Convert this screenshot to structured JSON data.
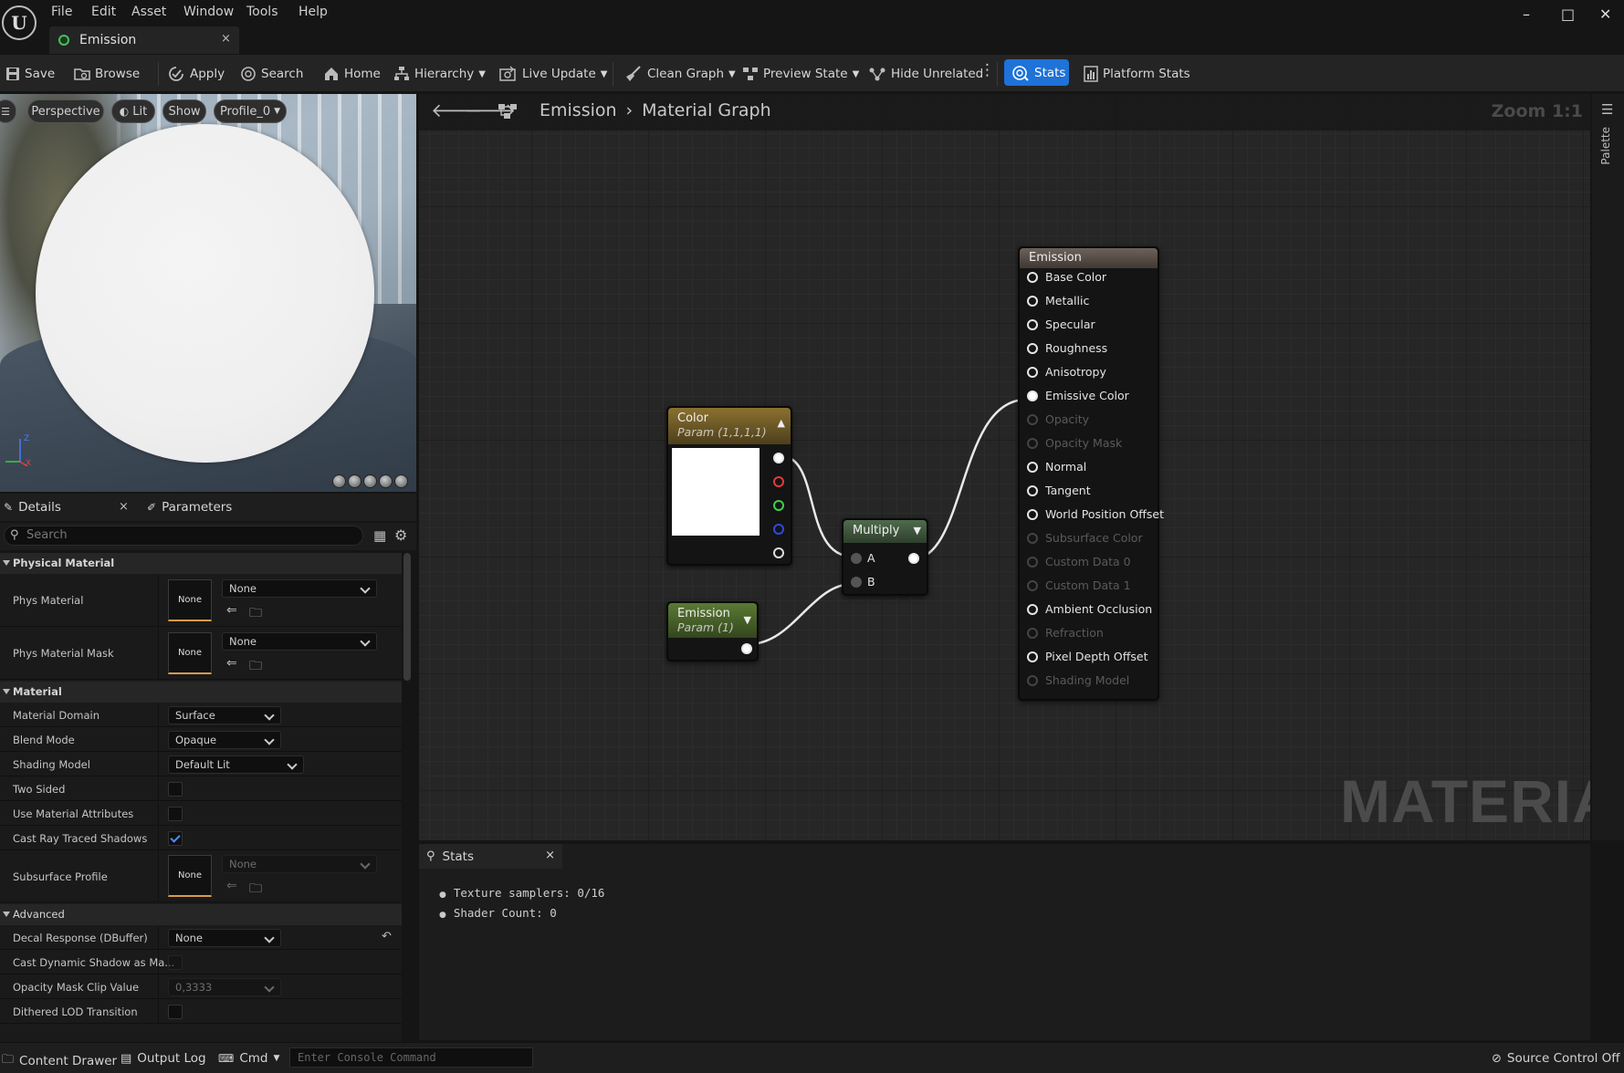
{
  "menu": [
    "File",
    "Edit",
    "Asset",
    "Window",
    "Tools",
    "Help"
  ],
  "tab": {
    "label": "Emission",
    "close": "×"
  },
  "window_controls": {
    "minimize": "–",
    "maximize": "□",
    "close": "✕"
  },
  "toolbar": {
    "save": "Save",
    "browse": "Browse",
    "apply": "Apply",
    "search": "Search",
    "home": "Home",
    "hierarchy": "Hierarchy",
    "live_update": "Live Update",
    "clean_graph": "Clean Graph",
    "preview_state": "Preview State",
    "hide_unrelated": "Hide Unrelated",
    "stats": "Stats",
    "platform_stats": "Platform Stats"
  },
  "viewport": {
    "perspective": "Perspective",
    "lit": "Lit",
    "show": "Show",
    "profile": "Profile_0",
    "axis_z": "Z",
    "axis_x": "X"
  },
  "details": {
    "tab_details": "Details",
    "tab_close": "×",
    "tab_parameters": "Parameters",
    "search_placeholder": "Search",
    "cat_physical": "Physical Material",
    "phys_material": "Phys Material",
    "phys_material_value": "None",
    "phys_material_thumb": "None",
    "phys_material_mask": "Phys Material Mask",
    "phys_material_mask_value": "None",
    "phys_material_mask_thumb": "None",
    "cat_material": "Material",
    "material_domain": "Material Domain",
    "material_domain_value": "Surface",
    "blend_mode": "Blend Mode",
    "blend_mode_value": "Opaque",
    "shading_model": "Shading Model",
    "shading_model_value": "Default Lit",
    "two_sided": "Two Sided",
    "use_material_attributes": "Use Material Attributes",
    "cast_ray_traced_shadows": "Cast Ray Traced Shadows",
    "subsurface_profile": "Subsurface Profile",
    "subsurface_profile_value": "None",
    "subsurface_profile_thumb": "None",
    "cat_advanced": "Advanced",
    "decal_response": "Decal Response (DBuffer)",
    "decal_response_value": "None",
    "cast_dynamic_shadow": "Cast Dynamic Shadow as Ma...",
    "opacity_mask_clip": "Opacity Mask Clip Value",
    "opacity_mask_clip_value": "0,3333",
    "dithered_lod": "Dithered LOD Transition",
    "checks": {
      "two_sided": false,
      "use_material_attributes": false,
      "cast_ray_traced_shadows": true,
      "cast_dynamic_shadow": false,
      "dithered_lod": false
    }
  },
  "graph": {
    "breadcrumb_asset": "Emission",
    "breadcrumb_sep": "›",
    "breadcrumb_graph": "Material Graph",
    "zoom": "Zoom 1:1",
    "watermark": "MATERIAL",
    "palette": "Palette",
    "color_node": {
      "title": "Color",
      "subtitle": "Param (1,1,1,1)",
      "header_color": "#8a7130"
    },
    "emission_param": {
      "title": "Emission",
      "subtitle": "Param (1)",
      "header_color": "#5a7a33"
    },
    "multiply": {
      "title": "Multiply",
      "pin_a": "A",
      "pin_b": "B",
      "header_color": "#4f6b4c"
    },
    "output": {
      "title": "Emission",
      "header_color": "#6d625a",
      "pins": [
        {
          "label": "Base Color",
          "enabled": true
        },
        {
          "label": "Metallic",
          "enabled": true
        },
        {
          "label": "Specular",
          "enabled": true
        },
        {
          "label": "Roughness",
          "enabled": true
        },
        {
          "label": "Anisotropy",
          "enabled": true
        },
        {
          "label": "Emissive Color",
          "enabled": true,
          "connected": true
        },
        {
          "label": "Opacity",
          "enabled": false
        },
        {
          "label": "Opacity Mask",
          "enabled": false
        },
        {
          "label": "Normal",
          "enabled": true
        },
        {
          "label": "Tangent",
          "enabled": true
        },
        {
          "label": "World Position Offset",
          "enabled": true
        },
        {
          "label": "Subsurface Color",
          "enabled": false
        },
        {
          "label": "Custom Data 0",
          "enabled": false
        },
        {
          "label": "Custom Data 1",
          "enabled": false
        },
        {
          "label": "Ambient Occlusion",
          "enabled": true
        },
        {
          "label": "Refraction",
          "enabled": false
        },
        {
          "label": "Pixel Depth Offset",
          "enabled": true
        },
        {
          "label": "Shading Model",
          "enabled": false
        }
      ]
    }
  },
  "stats": {
    "tab": "Stats",
    "close": "×",
    "lines": [
      "Texture samplers: 0/16",
      "Shader Count: 0"
    ]
  },
  "bottom": {
    "content_drawer": "Content Drawer",
    "output_log": "Output Log",
    "cmd": "Cmd",
    "console_placeholder": "Enter Console Command",
    "source_control": "Source Control Off"
  }
}
